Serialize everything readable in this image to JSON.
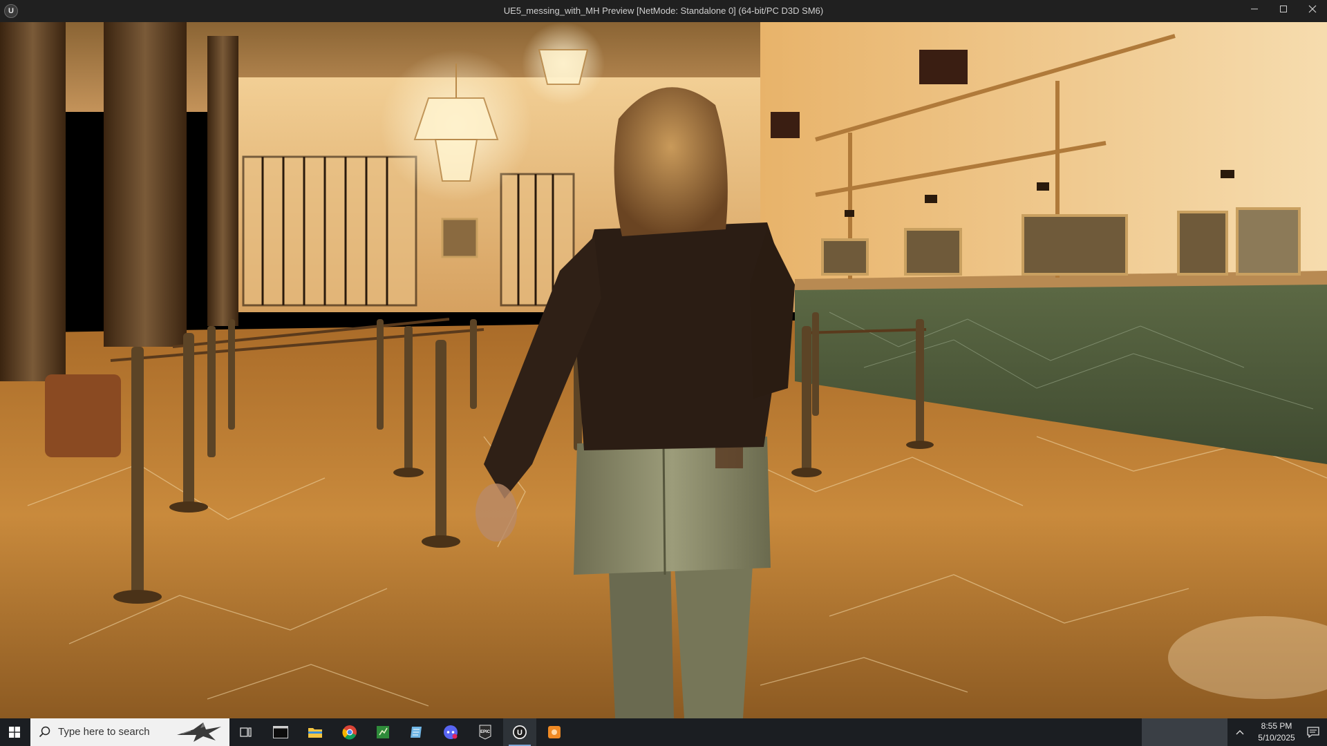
{
  "window": {
    "title": "UE5_messing_with_MH Preview [NetMode: Standalone 0]  (64-bit/PC D3D SM6)",
    "logo_glyph": "U",
    "controls": [
      "minimize-icon",
      "maximize-icon",
      "close-icon"
    ]
  },
  "viewport": {
    "scene": "bank-lobby-third-person",
    "colors": {
      "wall": "#e8b36a",
      "floor": "#c98a3c",
      "marble_dark": "#5a3a1c",
      "counter_marble": "#4d5a3a",
      "shirt": "#2b1d14",
      "jeans": "#8a8a6a",
      "hair": "#b08040"
    }
  },
  "taskbar": {
    "search_placeholder": "Type here to search",
    "apps": [
      {
        "name": "task-view-icon"
      },
      {
        "name": "terminal-icon"
      },
      {
        "name": "file-explorer-icon"
      },
      {
        "name": "chrome-icon"
      },
      {
        "name": "spreadsheet-icon"
      },
      {
        "name": "notes-icon"
      },
      {
        "name": "chat-icon"
      },
      {
        "name": "epic-games-icon",
        "label": "EPIC"
      },
      {
        "name": "unreal-engine-icon",
        "label": "U"
      },
      {
        "name": "orange-app-icon"
      }
    ],
    "time": "8:55 PM",
    "date": "5/10/2025",
    "accent": "#7fa7d6"
  }
}
